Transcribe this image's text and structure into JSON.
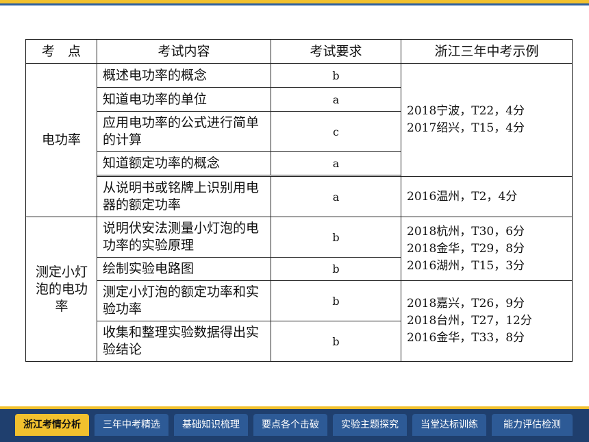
{
  "table": {
    "headers": [
      "考　点",
      "考试内容",
      "考试要求",
      "浙江三年中考示例"
    ],
    "groups": [
      {
        "point": "电功率",
        "rows": [
          {
            "content": "概述电功率的概念",
            "requirement": "b"
          },
          {
            "content": "知道电功率的单位",
            "requirement": "a"
          },
          {
            "content": "应用电功率的公式进行简单的计算",
            "requirement": "c"
          },
          {
            "content": "知道额定功率的概念",
            "requirement": "a"
          },
          {
            "content": "从说明书或铭牌上识别用电器的额定功率",
            "requirement": "a"
          }
        ],
        "examples": [
          [
            "2018宁波，T22，4分",
            "2017绍兴，T15，4分"
          ],
          [
            "2016温州，T2，4分"
          ]
        ]
      },
      {
        "point": "测定小灯泡的电功率",
        "rows": [
          {
            "content": "说明伏安法测量小灯泡的电功率的实验原理",
            "requirement": "b"
          },
          {
            "content": "绘制实验电路图",
            "requirement": "b"
          },
          {
            "content": "测定小灯泡的额定功率和实验功率",
            "requirement": "b"
          },
          {
            "content": "收集和整理实验数据得出实验结论",
            "requirement": "b"
          }
        ],
        "examples": [
          [
            "2018杭州，T30，6分",
            "2018金华，T29，8分",
            "2016湖州，T15，3分"
          ],
          [
            "2018嘉兴，T26，9分",
            "2018台州，T27，12分",
            "2016金华，T33，8分"
          ]
        ]
      }
    ]
  },
  "nav": {
    "tabs": [
      "浙江考情分析",
      "三年中考精选",
      "基础知识梳理",
      "要点各个击破",
      "实验主题探究",
      "当堂达标训练",
      "能力评估检测"
    ],
    "active_index": 0
  }
}
